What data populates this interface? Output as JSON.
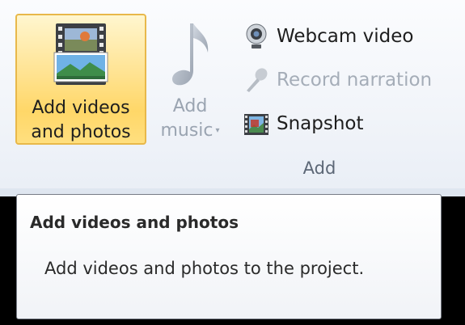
{
  "ribbon": {
    "add_videos_button": {
      "label_line1": "Add videos",
      "label_line2": "and photos",
      "icon": "film-strip-photo-icon"
    },
    "add_music_button": {
      "label_line1": "Add",
      "label_line2": "music",
      "icon": "music-note-icon",
      "disabled": true
    },
    "webcam_video": {
      "label": "Webcam video",
      "icon": "webcam-icon"
    },
    "record_narration": {
      "label": "Record narration",
      "icon": "microphone-icon",
      "disabled": true
    },
    "snapshot": {
      "label": "Snapshot",
      "icon": "snapshot-icon"
    },
    "group_label": "Add"
  },
  "tooltip": {
    "title": "Add videos and photos",
    "description": "Add videos and photos to the project."
  }
}
